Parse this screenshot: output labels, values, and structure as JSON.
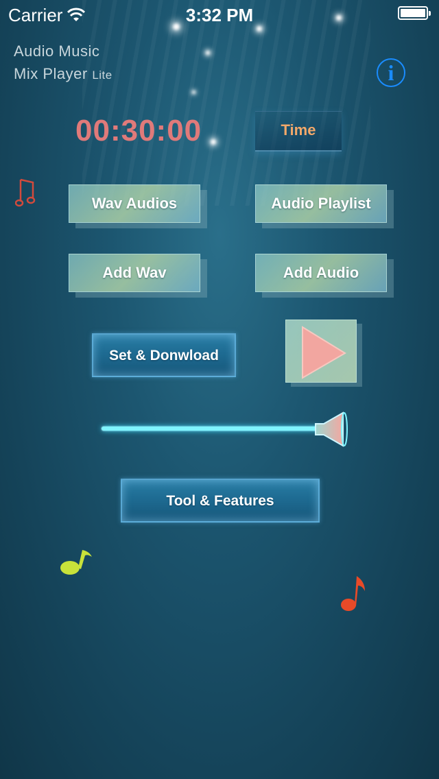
{
  "status_bar": {
    "carrier": "Carrier",
    "time": "3:32 PM",
    "wifi_icon": "wifi-icon",
    "battery_icon": "battery-icon"
  },
  "header": {
    "title_line1": "Audio Music",
    "title_line2": "Mix Player",
    "title_suffix": "Lite",
    "info_label": "i"
  },
  "timer": {
    "value": "00:30:00",
    "time_button": "Time"
  },
  "buttons": {
    "wav_audios": "Wav Audios",
    "audio_playlist": "Audio Playlist",
    "add_wav": "Add Wav",
    "add_audio": "Add Audio",
    "set_download": "Set & Donwload",
    "tool_features": "Tool & Features"
  },
  "controls": {
    "play_icon": "play-icon",
    "volume_icon": "speaker-cone-icon"
  },
  "colors": {
    "timer": "#e07a7a",
    "time_button": "#f2a86a",
    "info": "#1a8cff",
    "slider": "#7ff4ff"
  }
}
